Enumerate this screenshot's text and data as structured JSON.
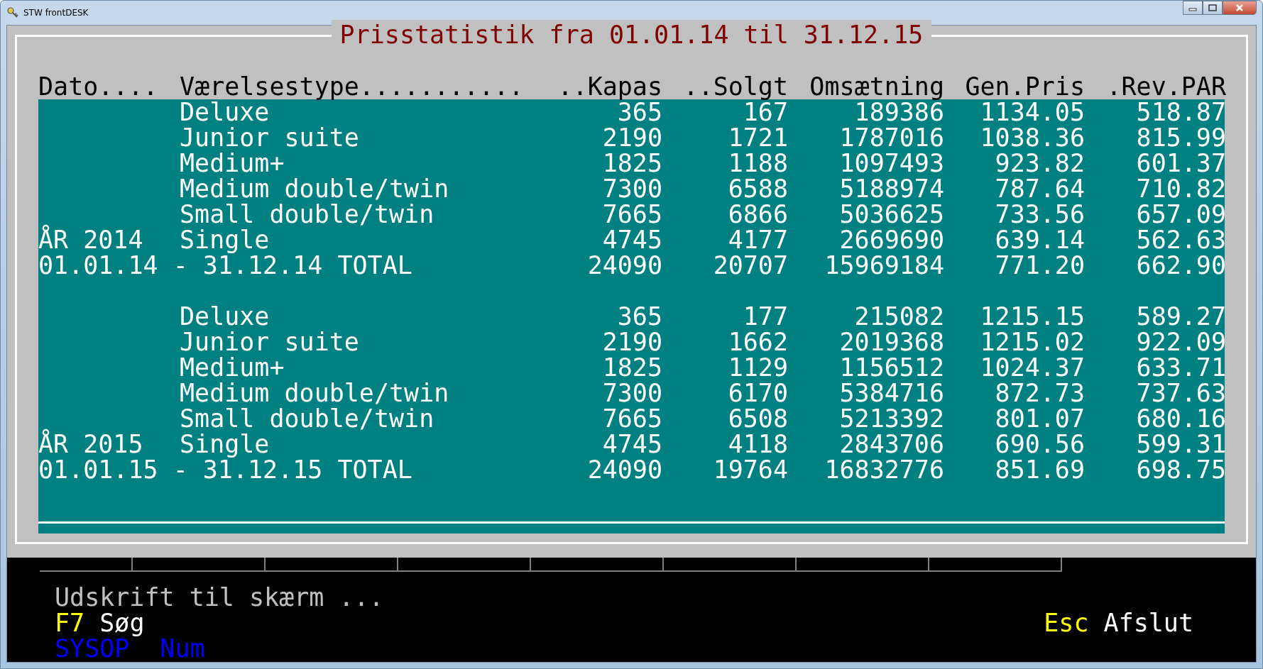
{
  "window": {
    "title": "STW frontDESK"
  },
  "report": {
    "title": "Prisstatistik fra 01.01.14 til 31.12.15",
    "columns": [
      "Dato....",
      "Værelsestype...........",
      "..Kapas",
      "..Solgt",
      "Omsætning",
      "Gen.Pris",
      ".Rev.PAR"
    ],
    "rows": [
      {
        "kind": "item",
        "type": "Deluxe",
        "values": [
          "365",
          "167",
          "189386",
          "1134.05",
          "518.87"
        ]
      },
      {
        "kind": "item",
        "type": "Junior suite",
        "values": [
          "2190",
          "1721",
          "1787016",
          "1038.36",
          "815.99"
        ]
      },
      {
        "kind": "item",
        "type": "Medium+",
        "values": [
          "1825",
          "1188",
          "1097493",
          "923.82",
          "601.37"
        ]
      },
      {
        "kind": "item",
        "type": "Medium double/twin",
        "values": [
          "7300",
          "6588",
          "5188974",
          "787.64",
          "710.82"
        ]
      },
      {
        "kind": "item",
        "type": "Small double/twin",
        "values": [
          "7665",
          "6866",
          "5036625",
          "733.56",
          "657.09"
        ]
      },
      {
        "kind": "item",
        "dato": "ÅR 2014",
        "type": "Single",
        "values": [
          "4745",
          "4177",
          "2669690",
          "639.14",
          "562.63"
        ]
      },
      {
        "kind": "total",
        "label": "01.01.14 - 31.12.14 TOTAL",
        "values": [
          "24090",
          "20707",
          "15969184",
          "771.20",
          "662.90"
        ]
      },
      {
        "kind": "blank"
      },
      {
        "kind": "item",
        "type": "Deluxe",
        "values": [
          "365",
          "177",
          "215082",
          "1215.15",
          "589.27"
        ]
      },
      {
        "kind": "item",
        "type": "Junior suite",
        "values": [
          "2190",
          "1662",
          "2019368",
          "1215.02",
          "922.09"
        ]
      },
      {
        "kind": "item",
        "type": "Medium+",
        "values": [
          "1825",
          "1129",
          "1156512",
          "1024.37",
          "633.71"
        ]
      },
      {
        "kind": "item",
        "type": "Medium double/twin",
        "values": [
          "7300",
          "6170",
          "5384716",
          "872.73",
          "737.63"
        ]
      },
      {
        "kind": "item",
        "type": "Small double/twin",
        "values": [
          "7665",
          "6508",
          "5213392",
          "801.07",
          "680.16"
        ]
      },
      {
        "kind": "item",
        "dato": "ÅR 2015",
        "type": "Single",
        "values": [
          "4745",
          "4118",
          "2843706",
          "690.56",
          "599.31"
        ]
      },
      {
        "kind": "total",
        "label": "01.01.15 - 31.12.15 TOTAL",
        "values": [
          "24090",
          "19764",
          "16832776",
          "851.69",
          "698.75"
        ]
      }
    ]
  },
  "status": {
    "message": "Udskrift til skærm ...",
    "left_keys": [
      {
        "key": "F7",
        "label": "Søg"
      }
    ],
    "right_keys": [
      {
        "key": "Esc",
        "label": "Afslut"
      }
    ],
    "indicators": [
      "SYSOP",
      "Num"
    ]
  }
}
